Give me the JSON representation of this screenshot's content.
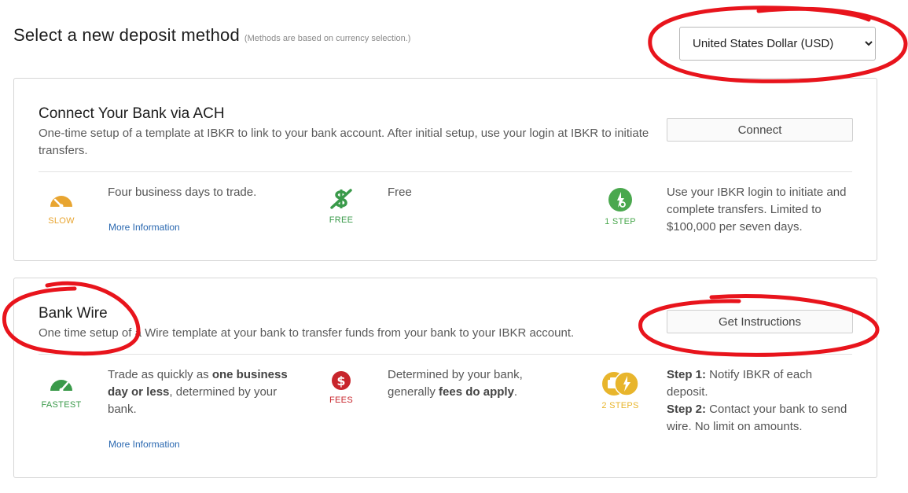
{
  "header": {
    "title": "Select a new deposit method",
    "subtitle": "(Methods are based on currency selection.)",
    "currency_selected": "United States Dollar (USD)"
  },
  "ach": {
    "title": "Connect Your Bank via ACH",
    "description": "One-time setup of a template at IBKR to link to your bank account. After initial setup, use your login at IBKR to initiate transfers.",
    "button_label": "Connect",
    "speed_label": "SLOW",
    "speed_text": "Four business days to trade.",
    "more_info": "More Information",
    "cost_label": "FREE",
    "cost_text": "Free",
    "steps_label": "1 STEP",
    "steps_text": "Use your IBKR login to initiate and complete transfers. Limited to $100,000 per seven days."
  },
  "wire": {
    "title": "Bank Wire",
    "description": "One time setup of a Wire template at your bank to transfer funds from your bank to your IBKR account.",
    "button_label": "Get Instructions",
    "speed_label": "FASTEST",
    "speed_text_1": "Trade as quickly as ",
    "speed_text_bold": "one business day or less",
    "speed_text_2": ", determined by your bank.",
    "more_info": "More Information",
    "cost_label": "FEES",
    "cost_text_1": "Determined by your bank, generally ",
    "cost_text_bold": "fees do apply",
    "cost_text_2": ".",
    "steps_label": "2 STEPS",
    "step1_label": "Step 1:",
    "step1_text": " Notify IBKR of each deposit.",
    "step2_label": "Step 2:",
    "step2_text": " Contact your bank to send wire. No limit on amounts."
  },
  "colors": {
    "slow": "#e8a531",
    "free": "#3a9a4a",
    "step": "#4aa84e",
    "fastest": "#3a9a4a",
    "fees": "#c8252c",
    "steps2": "#e8b52c",
    "annotation": "#e8141c",
    "link": "#2a68b0"
  }
}
